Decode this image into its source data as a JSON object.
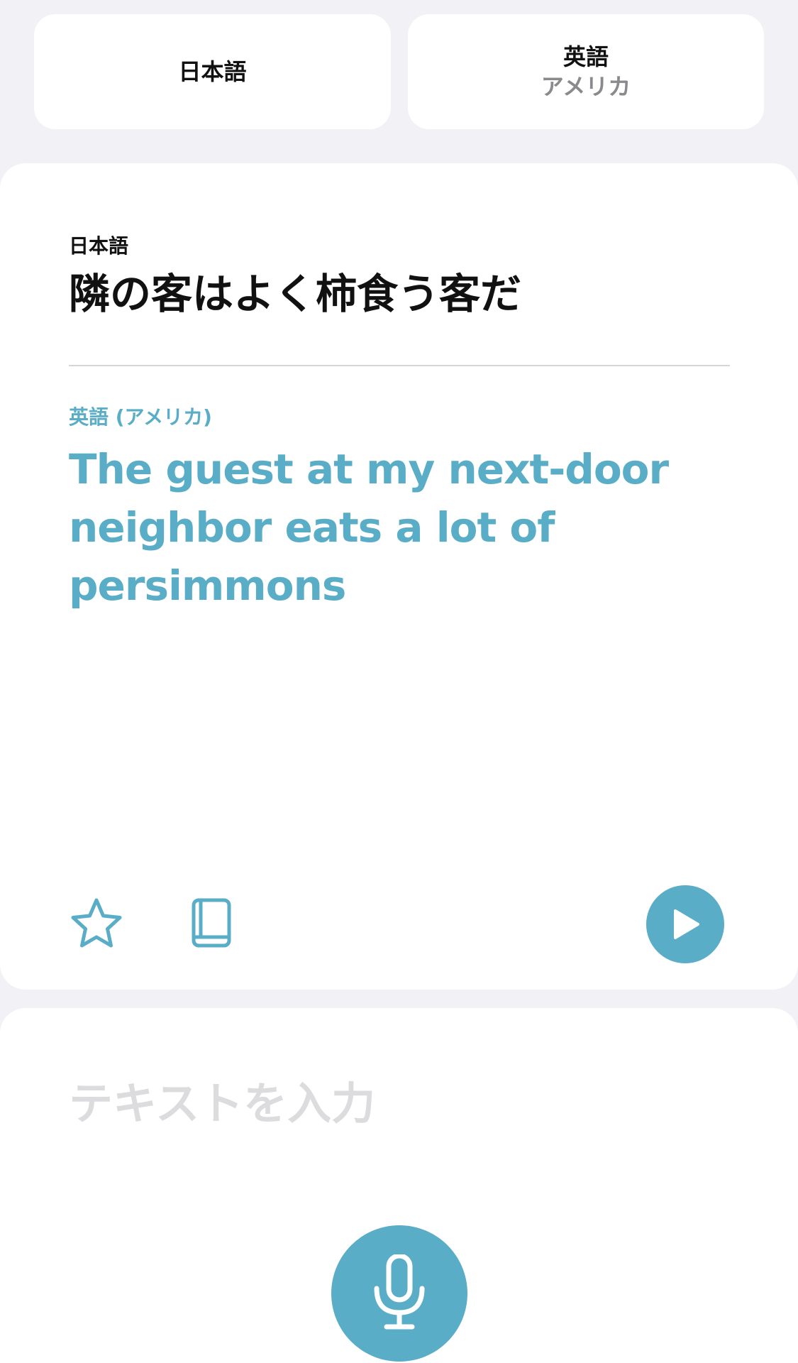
{
  "language_selector": {
    "source": {
      "label": "日本語"
    },
    "target": {
      "label": "英語",
      "region": "アメリカ"
    }
  },
  "translation": {
    "source_language": "日本語",
    "source_text": "隣の客はよく柿食う客だ",
    "target_language": "英語 (アメリカ)",
    "target_text": "The guest at my next-door neighbor eats a lot of persimmons"
  },
  "actions": {
    "favorite_icon": "star-icon",
    "dictionary_icon": "book-icon",
    "play_icon": "play-icon"
  },
  "input": {
    "placeholder": "テキストを入力",
    "mic_icon": "microphone-icon"
  },
  "colors": {
    "accent": "#5aadc6",
    "background": "#f2f2f6",
    "card": "#ffffff",
    "placeholder": "#dcdcdf",
    "secondary_text": "#8a8a8e"
  }
}
